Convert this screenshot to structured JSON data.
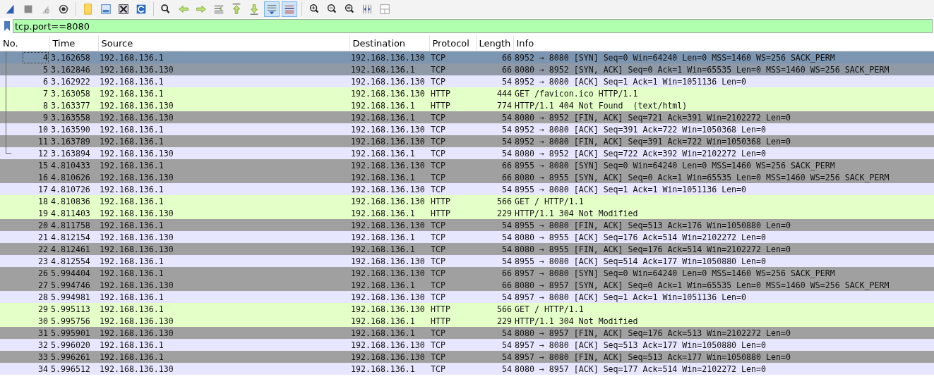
{
  "toolbar": [
    {
      "kind": "shark",
      "on": false
    },
    {
      "kind": "stop",
      "on": false
    },
    {
      "kind": "restart",
      "on": false
    },
    {
      "kind": "options",
      "on": false
    },
    {
      "kind": "sep"
    },
    {
      "kind": "open",
      "on": false
    },
    {
      "kind": "save",
      "on": false
    },
    {
      "kind": "close",
      "on": false
    },
    {
      "kind": "reload",
      "on": false
    },
    {
      "kind": "sep"
    },
    {
      "kind": "find",
      "on": false
    },
    {
      "kind": "back",
      "on": false
    },
    {
      "kind": "forward",
      "on": false
    },
    {
      "kind": "goto",
      "on": false
    },
    {
      "kind": "first",
      "on": false
    },
    {
      "kind": "last",
      "on": false
    },
    {
      "kind": "autoscroll",
      "on": true
    },
    {
      "kind": "colorize",
      "on": true
    },
    {
      "kind": "sep"
    },
    {
      "kind": "zoomin",
      "on": false
    },
    {
      "kind": "zoomout",
      "on": false
    },
    {
      "kind": "zoomreset",
      "on": false
    },
    {
      "kind": "resize",
      "on": false
    },
    {
      "kind": "columns",
      "on": false
    }
  ],
  "filter": {
    "value": "tcp.port==8080"
  },
  "table": {
    "columns": [
      "No.",
      "Time",
      "Source",
      "Destination",
      "Protocol",
      "Length",
      "Info"
    ],
    "rows": [
      {
        "cells": [
          "4",
          "3.162658",
          "192.168.136.1",
          "192.168.136.130",
          "TCP",
          "66",
          "8952 → 8080 [SYN] Seq=0 Win=64240 Len=0 MSS=1460 WS=256 SACK_PERM"
        ],
        "color": "#7c95b0",
        "selected": true,
        "related": true
      },
      {
        "cells": [
          "5",
          "3.162846",
          "192.168.136.130",
          "192.168.136.1",
          "TCP",
          "66",
          "8080 → 8952 [SYN, ACK] Seq=0 Ack=1 Win=65535 Len=0 MSS=1460 WS=256 SACK_PERM"
        ],
        "color": "#8f9aa6",
        "selected": false,
        "related": true
      },
      {
        "cells": [
          "6",
          "3.162922",
          "192.168.136.1",
          "192.168.136.130",
          "TCP",
          "54",
          "8952 → 8080 [ACK] Seq=1 Ack=1 Win=1051136 Len=0"
        ],
        "color": "#e7e6ff",
        "selected": false,
        "related": true
      },
      {
        "cells": [
          "7",
          "3.163058",
          "192.168.136.1",
          "192.168.136.130",
          "HTTP",
          "444",
          "GET /favicon.ico HTTP/1.1"
        ],
        "color": "#e4ffc7",
        "selected": false,
        "related": true
      },
      {
        "cells": [
          "8",
          "3.163377",
          "192.168.136.130",
          "192.168.136.1",
          "HTTP",
          "774",
          "HTTP/1.1 404 Not Found  (text/html)"
        ],
        "color": "#e4ffc7",
        "selected": false,
        "related": true
      },
      {
        "cells": [
          "9",
          "3.163558",
          "192.168.136.130",
          "192.168.136.1",
          "TCP",
          "54",
          "8080 → 8952 [FIN, ACK] Seq=721 Ack=391 Win=2102272 Len=0"
        ],
        "color": "#a0a0a0",
        "selected": false,
        "related": true
      },
      {
        "cells": [
          "10",
          "3.163590",
          "192.168.136.1",
          "192.168.136.130",
          "TCP",
          "54",
          "8952 → 8080 [ACK] Seq=391 Ack=722 Win=1050368 Len=0"
        ],
        "color": "#e7e6ff",
        "selected": false,
        "related": true
      },
      {
        "cells": [
          "11",
          "3.163789",
          "192.168.136.1",
          "192.168.136.130",
          "TCP",
          "54",
          "8952 → 8080 [FIN, ACK] Seq=391 Ack=722 Win=1050368 Len=0"
        ],
        "color": "#a0a0a0",
        "selected": false,
        "related": true
      },
      {
        "cells": [
          "12",
          "3.163894",
          "192.168.136.130",
          "192.168.136.1",
          "TCP",
          "54",
          "8080 → 8952 [ACK] Seq=722 Ack=392 Win=2102272 Len=0"
        ],
        "color": "#e7e6ff",
        "selected": false,
        "related": true
      },
      {
        "cells": [
          "15",
          "4.810433",
          "192.168.136.1",
          "192.168.136.130",
          "TCP",
          "66",
          "8955 → 8080 [SYN] Seq=0 Win=64240 Len=0 MSS=1460 WS=256 SACK_PERM"
        ],
        "color": "#a0a0a0",
        "selected": false,
        "related": false
      },
      {
        "cells": [
          "16",
          "4.810626",
          "192.168.136.130",
          "192.168.136.1",
          "TCP",
          "66",
          "8080 → 8955 [SYN, ACK] Seq=0 Ack=1 Win=65535 Len=0 MSS=1460 WS=256 SACK_PERM"
        ],
        "color": "#a0a0a0",
        "selected": false,
        "related": false
      },
      {
        "cells": [
          "17",
          "4.810726",
          "192.168.136.1",
          "192.168.136.130",
          "TCP",
          "54",
          "8955 → 8080 [ACK] Seq=1 Ack=1 Win=1051136 Len=0"
        ],
        "color": "#e7e6ff",
        "selected": false,
        "related": false
      },
      {
        "cells": [
          "18",
          "4.810836",
          "192.168.136.1",
          "192.168.136.130",
          "HTTP",
          "566",
          "GET / HTTP/1.1"
        ],
        "color": "#e4ffc7",
        "selected": false,
        "related": false
      },
      {
        "cells": [
          "19",
          "4.811403",
          "192.168.136.130",
          "192.168.136.1",
          "HTTP",
          "229",
          "HTTP/1.1 304 Not Modified"
        ],
        "color": "#e4ffc7",
        "selected": false,
        "related": false
      },
      {
        "cells": [
          "20",
          "4.811758",
          "192.168.136.1",
          "192.168.136.130",
          "TCP",
          "54",
          "8955 → 8080 [FIN, ACK] Seq=513 Ack=176 Win=1050880 Len=0"
        ],
        "color": "#a0a0a0",
        "selected": false,
        "related": false
      },
      {
        "cells": [
          "21",
          "4.812154",
          "192.168.136.130",
          "192.168.136.1",
          "TCP",
          "54",
          "8080 → 8955 [ACK] Seq=176 Ack=514 Win=2102272 Len=0"
        ],
        "color": "#e7e6ff",
        "selected": false,
        "related": false
      },
      {
        "cells": [
          "22",
          "4.812461",
          "192.168.136.130",
          "192.168.136.1",
          "TCP",
          "54",
          "8080 → 8955 [FIN, ACK] Seq=176 Ack=514 Win=2102272 Len=0"
        ],
        "color": "#a0a0a0",
        "selected": false,
        "related": false
      },
      {
        "cells": [
          "23",
          "4.812554",
          "192.168.136.1",
          "192.168.136.130",
          "TCP",
          "54",
          "8955 → 8080 [ACK] Seq=514 Ack=177 Win=1050880 Len=0"
        ],
        "color": "#e7e6ff",
        "selected": false,
        "related": false
      },
      {
        "cells": [
          "26",
          "5.994404",
          "192.168.136.1",
          "192.168.136.130",
          "TCP",
          "66",
          "8957 → 8080 [SYN] Seq=0 Win=64240 Len=0 MSS=1460 WS=256 SACK_PERM"
        ],
        "color": "#a0a0a0",
        "selected": false,
        "related": false
      },
      {
        "cells": [
          "27",
          "5.994746",
          "192.168.136.130",
          "192.168.136.1",
          "TCP",
          "66",
          "8080 → 8957 [SYN, ACK] Seq=0 Ack=1 Win=65535 Len=0 MSS=1460 WS=256 SACK_PERM"
        ],
        "color": "#a0a0a0",
        "selected": false,
        "related": false
      },
      {
        "cells": [
          "28",
          "5.994981",
          "192.168.136.1",
          "192.168.136.130",
          "TCP",
          "54",
          "8957 → 8080 [ACK] Seq=1 Ack=1 Win=1051136 Len=0"
        ],
        "color": "#e7e6ff",
        "selected": false,
        "related": false
      },
      {
        "cells": [
          "29",
          "5.995113",
          "192.168.136.1",
          "192.168.136.130",
          "HTTP",
          "566",
          "GET / HTTP/1.1"
        ],
        "color": "#e4ffc7",
        "selected": false,
        "related": false
      },
      {
        "cells": [
          "30",
          "5.995756",
          "192.168.136.130",
          "192.168.136.1",
          "HTTP",
          "229",
          "HTTP/1.1 304 Not Modified"
        ],
        "color": "#e4ffc7",
        "selected": false,
        "related": false
      },
      {
        "cells": [
          "31",
          "5.995901",
          "192.168.136.130",
          "192.168.136.1",
          "TCP",
          "54",
          "8080 → 8957 [FIN, ACK] Seq=176 Ack=513 Win=2102272 Len=0"
        ],
        "color": "#a0a0a0",
        "selected": false,
        "related": false
      },
      {
        "cells": [
          "32",
          "5.996020",
          "192.168.136.1",
          "192.168.136.130",
          "TCP",
          "54",
          "8957 → 8080 [ACK] Seq=513 Ack=177 Win=1050880 Len=0"
        ],
        "color": "#e7e6ff",
        "selected": false,
        "related": false
      },
      {
        "cells": [
          "33",
          "5.996261",
          "192.168.136.1",
          "192.168.136.130",
          "TCP",
          "54",
          "8957 → 8080 [FIN, ACK] Seq=513 Ack=177 Win=1050880 Len=0"
        ],
        "color": "#a0a0a0",
        "selected": false,
        "related": false
      },
      {
        "cells": [
          "34",
          "5.996512",
          "192.168.136.130",
          "192.168.136.1",
          "TCP",
          "54",
          "8080 → 8957 [ACK] Seq=177 Ack=514 Win=2102272 Len=0"
        ],
        "color": "#e7e6ff",
        "selected": false,
        "related": false
      }
    ]
  }
}
